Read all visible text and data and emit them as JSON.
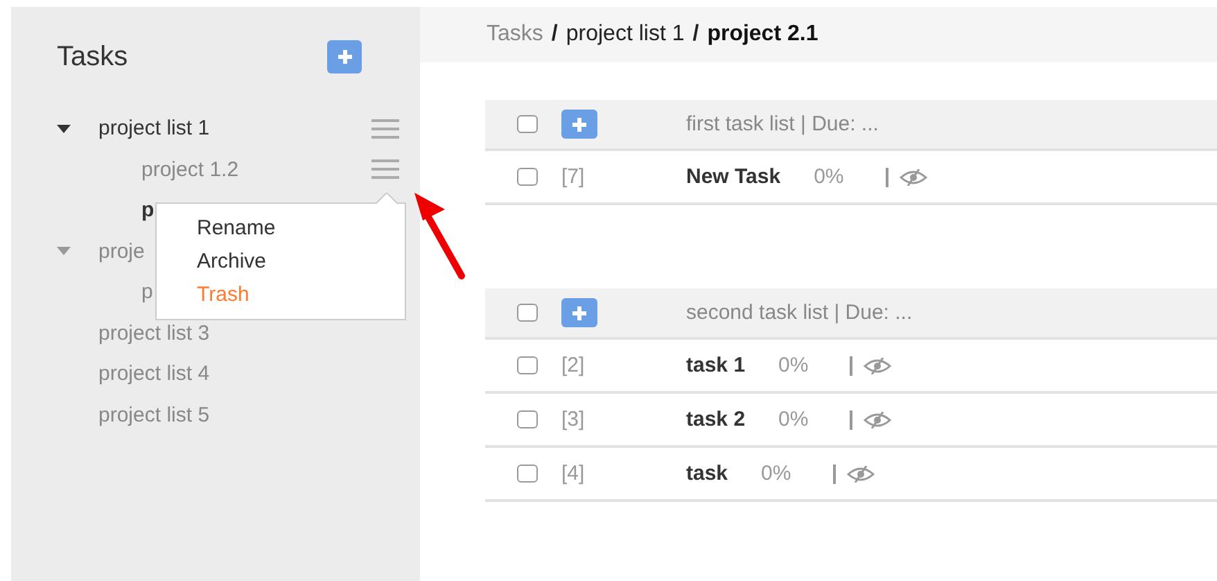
{
  "sidebar": {
    "title": "Tasks",
    "tree": [
      {
        "label": "project list 1",
        "active": true,
        "expanded": true,
        "menu": true,
        "children": [
          {
            "label": "project 1.2",
            "active": false,
            "menu": true
          },
          {
            "label": "p",
            "active": true
          }
        ]
      },
      {
        "label": "proje",
        "active": false,
        "expanded": true,
        "children": [
          {
            "label": "p",
            "active": false
          }
        ]
      },
      {
        "label": "project list 3",
        "active": false
      },
      {
        "label": "project list 4",
        "active": false
      },
      {
        "label": "project list 5",
        "active": false
      }
    ],
    "context_menu": [
      {
        "label": "Rename",
        "color": "#333333"
      },
      {
        "label": "Archive",
        "color": "#333333"
      },
      {
        "label": "Trash",
        "color": "#ff7b2e"
      }
    ]
  },
  "breadcrumb": [
    {
      "label": "Tasks",
      "current": false,
      "muted": true
    },
    {
      "separator": "/",
      "label": "project list 1",
      "current": false,
      "muted": false
    },
    {
      "separator": "/",
      "label": "project 2.1",
      "current": true,
      "muted": false
    }
  ],
  "task_lists": [
    {
      "title": "first task list | Due: ...",
      "checked": false,
      "tasks": [
        {
          "id": "[7]",
          "name": "New Task",
          "progress": "0%",
          "checked": false
        }
      ]
    },
    {
      "title": "second task list | Due: ...",
      "checked": false,
      "tasks": [
        {
          "id": "[2]",
          "name": "task 1",
          "progress": "0%",
          "checked": false
        },
        {
          "id": "[3]",
          "name": "task 2",
          "progress": "0%",
          "checked": false
        },
        {
          "id": "[4]",
          "name": "task",
          "progress": "0%",
          "checked": false
        }
      ]
    }
  ]
}
